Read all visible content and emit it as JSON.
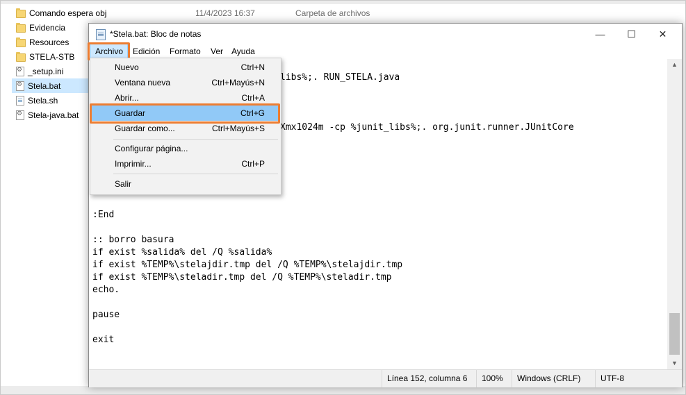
{
  "explorer": {
    "files": [
      {
        "name": "Comando espera obj",
        "icon": "folder-icon"
      },
      {
        "name": "Evidencia",
        "icon": "folder-icon"
      },
      {
        "name": "Resources",
        "icon": "folder-icon"
      },
      {
        "name": "STELA-STB",
        "icon": "folder-icon"
      },
      {
        "name": "_setup.ini",
        "icon": "settings-file-icon"
      },
      {
        "name": "Stela.bat",
        "icon": "batch-file-icon",
        "selected": true
      },
      {
        "name": "Stela.sh",
        "icon": "script-file-icon"
      },
      {
        "name": "Stela-java.bat",
        "icon": "batch-file-icon"
      }
    ],
    "first_row_date": "11/4/2023 16:37",
    "first_row_type": "Carpeta de archivos"
  },
  "notepad": {
    "title": "*Stela.bat: Bloc de notas",
    "menu": [
      "Archivo",
      "Edición",
      "Formato",
      "Ver",
      "Ayuda"
    ],
    "active_menu": "Archivo",
    "window_controls": {
      "minimize": "—",
      "maximize": "☐",
      "close": "✕"
    },
    "editor_lines": [
      "libs%;. RUN_STELA.java",
      "Xmx1024m -cp %junit_libs%;. org.junit.runner.JUnitCore",
      ":End",
      ":: borro basura",
      "if exist %salida% del /Q %salida%",
      "if exist %TEMP%\\stelajdir.tmp del /Q %TEMP%\\stelajdir.tmp",
      "if exist %TEMP%\\steladir.tmp del /Q %TEMP%\\steladir.tmp",
      "echo.",
      "pause",
      "exit"
    ],
    "status": {
      "position": "Línea 152, columna 6",
      "zoom": "100%",
      "line_ending": "Windows (CRLF)",
      "encoding": "UTF-8"
    }
  },
  "file_menu": {
    "items": [
      {
        "label": "Nuevo",
        "shortcut": "Ctrl+N"
      },
      {
        "label": "Ventana nueva",
        "shortcut": "Ctrl+Mayús+N"
      },
      {
        "label": "Abrir...",
        "shortcut": "Ctrl+A"
      },
      {
        "label": "Guardar",
        "shortcut": "Ctrl+G",
        "highlighted": true
      },
      {
        "label": "Guardar como...",
        "shortcut": "Ctrl+Mayús+S"
      },
      {
        "label": "Configurar página...",
        "shortcut": ""
      },
      {
        "label": "Imprimir...",
        "shortcut": "Ctrl+P"
      },
      {
        "label": "Salir",
        "shortcut": ""
      }
    ]
  },
  "colors": {
    "highlight_outline": "#ed7d31",
    "menu_hover": "#91c9f7",
    "selection": "#cce8ff"
  }
}
